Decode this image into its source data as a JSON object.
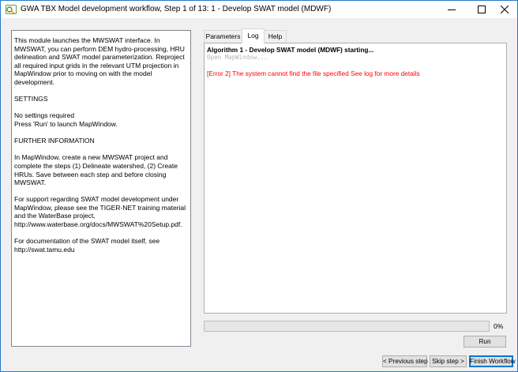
{
  "window": {
    "title": "GWA TBX Model development workflow, Step 1 of 13: 1 - Develop SWAT model (MDWF)"
  },
  "description": {
    "paragraphs": [
      "This module launches the MWSWAT interface. In MWSWAT, you can perform DEM hydro-processing, HRU delineation and SWAT model parameterization. Reproject all required input grids in the relevant UTM projection in MapWindow prior to moving on with the model development.",
      "SETTINGS",
      "No settings required\nPress 'Run' to launch MapWindow.",
      "FURTHER INFORMATION",
      "In MapWindow, create a new MWSWAT project and complete the steps (1) Delineate watershed, (2) Create HRUs. Save between each step and before closing MWSWAT.",
      "For support regarding SWAT model development under MapWindow, please see the TIGER-NET training material and the WaterBase project, http://www.waterbase.org/docs/MWSWAT%20Setup.pdf.",
      "For documentation of the SWAT model itself, see http://swat.tamu.edu"
    ]
  },
  "tabs": [
    {
      "label": "Parameters",
      "active": false
    },
    {
      "label": "Log",
      "active": true
    },
    {
      "label": "Help",
      "active": false
    }
  ],
  "log": {
    "title": "Algorithm 1 - Develop SWAT model (MDWF) starting...",
    "muted": "Open MapWindow...",
    "error": "[Error 2] The system cannot find the file specified See log for more details"
  },
  "progress": {
    "value": 0,
    "label": "0%"
  },
  "buttons": {
    "run": "Run",
    "previous": "< Previous step",
    "skip": "Skip step >",
    "finish": "Finish Workflow"
  },
  "colors": {
    "error": "#ff0000",
    "window_border": "#2b79c9",
    "default_button_border": "#0078d7"
  },
  "icons": {
    "app": "qgis-app-icon",
    "minimize": "minimize-icon",
    "maximize": "maximize-icon",
    "close": "close-icon"
  }
}
